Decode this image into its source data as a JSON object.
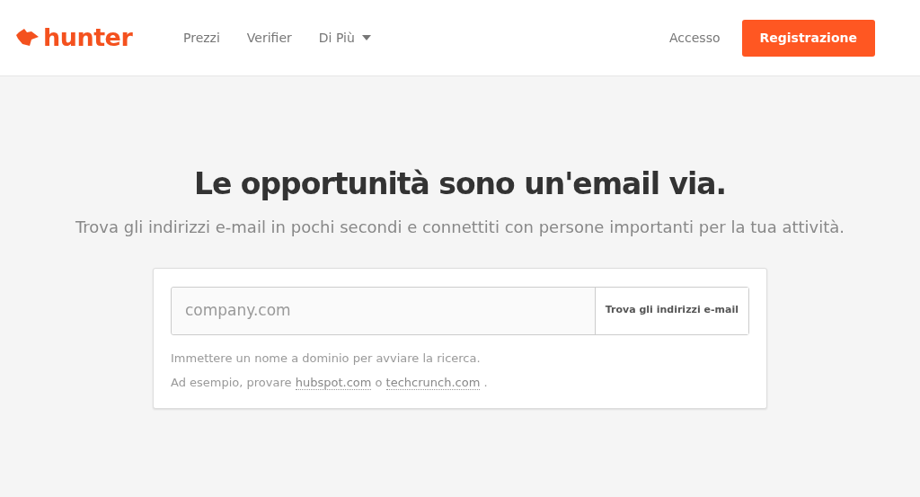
{
  "navbar": {
    "logo": "hunter",
    "links": [
      {
        "label": "Prezzi",
        "kind": "link"
      },
      {
        "label": "Verifier",
        "kind": "link"
      },
      {
        "label": "Di Più",
        "kind": "dropdown"
      }
    ],
    "login": "Accesso",
    "signup": "Registrazione"
  },
  "hero": {
    "title": "Le opportunità sono un'email via.",
    "subtitle": "Trova gli indirizzi e-mail in pochi secondi e connettiti con persone importanti per la tua attività."
  },
  "search": {
    "placeholder": "company.com",
    "button": "Trova gli indirizzi e-mail",
    "hint": "Immettere un nome a dominio per avviare la ricerca.",
    "example": {
      "prefix": "Ad esempio, provare ",
      "links": [
        "hubspot.com",
        "techcrunch.com"
      ],
      "separator": " o ",
      "suffix": " ."
    }
  }
}
